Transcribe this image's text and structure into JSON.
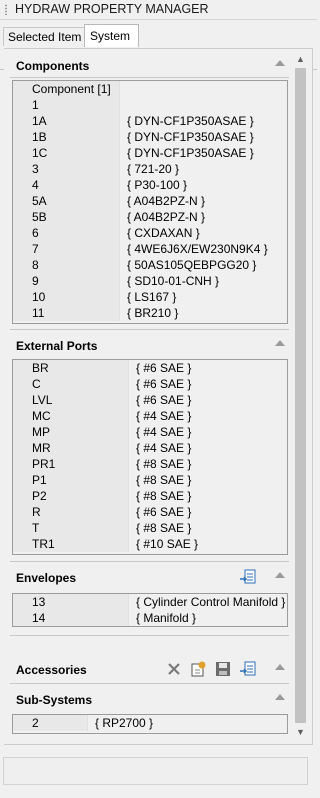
{
  "window": {
    "title": "HYDRAW PROPERTY MANAGER"
  },
  "tabs": [
    {
      "label": "Selected Item",
      "selected": false
    },
    {
      "label": "System",
      "selected": true
    }
  ],
  "sections": {
    "components": {
      "title": "Components",
      "header": {
        "id": "Component [1]",
        "value": ""
      },
      "rows": [
        {
          "id": "1",
          "value": ""
        },
        {
          "id": "1A",
          "value": "{ DYN-CF1P350ASAE }"
        },
        {
          "id": "1B",
          "value": "{ DYN-CF1P350ASAE }"
        },
        {
          "id": "1C",
          "value": "{ DYN-CF1P350ASAE }"
        },
        {
          "id": "3",
          "value": "{ 721-20 }"
        },
        {
          "id": "4",
          "value": "{ P30-100 }"
        },
        {
          "id": "5A",
          "value": "{ A04B2PZ-N }"
        },
        {
          "id": "5B",
          "value": "{ A04B2PZ-N }"
        },
        {
          "id": "6",
          "value": "{ CXDAXAN }"
        },
        {
          "id": "7",
          "value": "{ 4WE6J6X/EW230N9K4 }"
        },
        {
          "id": "8",
          "value": "{ 50AS105QEBPGG20 }"
        },
        {
          "id": "9",
          "value": "{ SD10-01-CNH }"
        },
        {
          "id": "10",
          "value": "{ LS167 }"
        },
        {
          "id": "11",
          "value": "{ BR210 }"
        }
      ]
    },
    "external_ports": {
      "title": "External Ports",
      "rows": [
        {
          "id": "BR",
          "value": "{ #6 SAE }"
        },
        {
          "id": "C",
          "value": "{ #6 SAE }"
        },
        {
          "id": "LVL",
          "value": "{ #6 SAE }"
        },
        {
          "id": "MC",
          "value": "{ #4 SAE }"
        },
        {
          "id": "MP",
          "value": "{ #4 SAE }"
        },
        {
          "id": "MR",
          "value": "{ #4 SAE }"
        },
        {
          "id": "PR1",
          "value": "{ #8 SAE }"
        },
        {
          "id": "P1",
          "value": "{ #8 SAE }"
        },
        {
          "id": "P2",
          "value": "{ #8 SAE }"
        },
        {
          "id": "R",
          "value": "{ #6 SAE }"
        },
        {
          "id": "T",
          "value": "{ #8 SAE }"
        },
        {
          "id": "TR1",
          "value": "{ #10 SAE }"
        }
      ]
    },
    "envelopes": {
      "title": "Envelopes",
      "rows": [
        {
          "id": "13",
          "value": "{ Cylinder Control Manifold }"
        },
        {
          "id": "14",
          "value": "{ Manifold }"
        }
      ]
    },
    "accessories": {
      "title": "Accessories"
    },
    "sub_systems": {
      "title": "Sub-Systems",
      "rows": [
        {
          "id": "2",
          "value": "{ RP2700 }"
        }
      ]
    }
  },
  "icons": {
    "export": "export-list-icon",
    "delete": "delete-icon",
    "new": "new-item-icon",
    "save": "save-icon",
    "collapse": "collapse-up-icon"
  },
  "colors": {
    "background": "#f0f0f0",
    "list_border": "#9c9c9c",
    "icon_blue": "#2d6fb7",
    "icon_orange": "#e0a12a"
  }
}
